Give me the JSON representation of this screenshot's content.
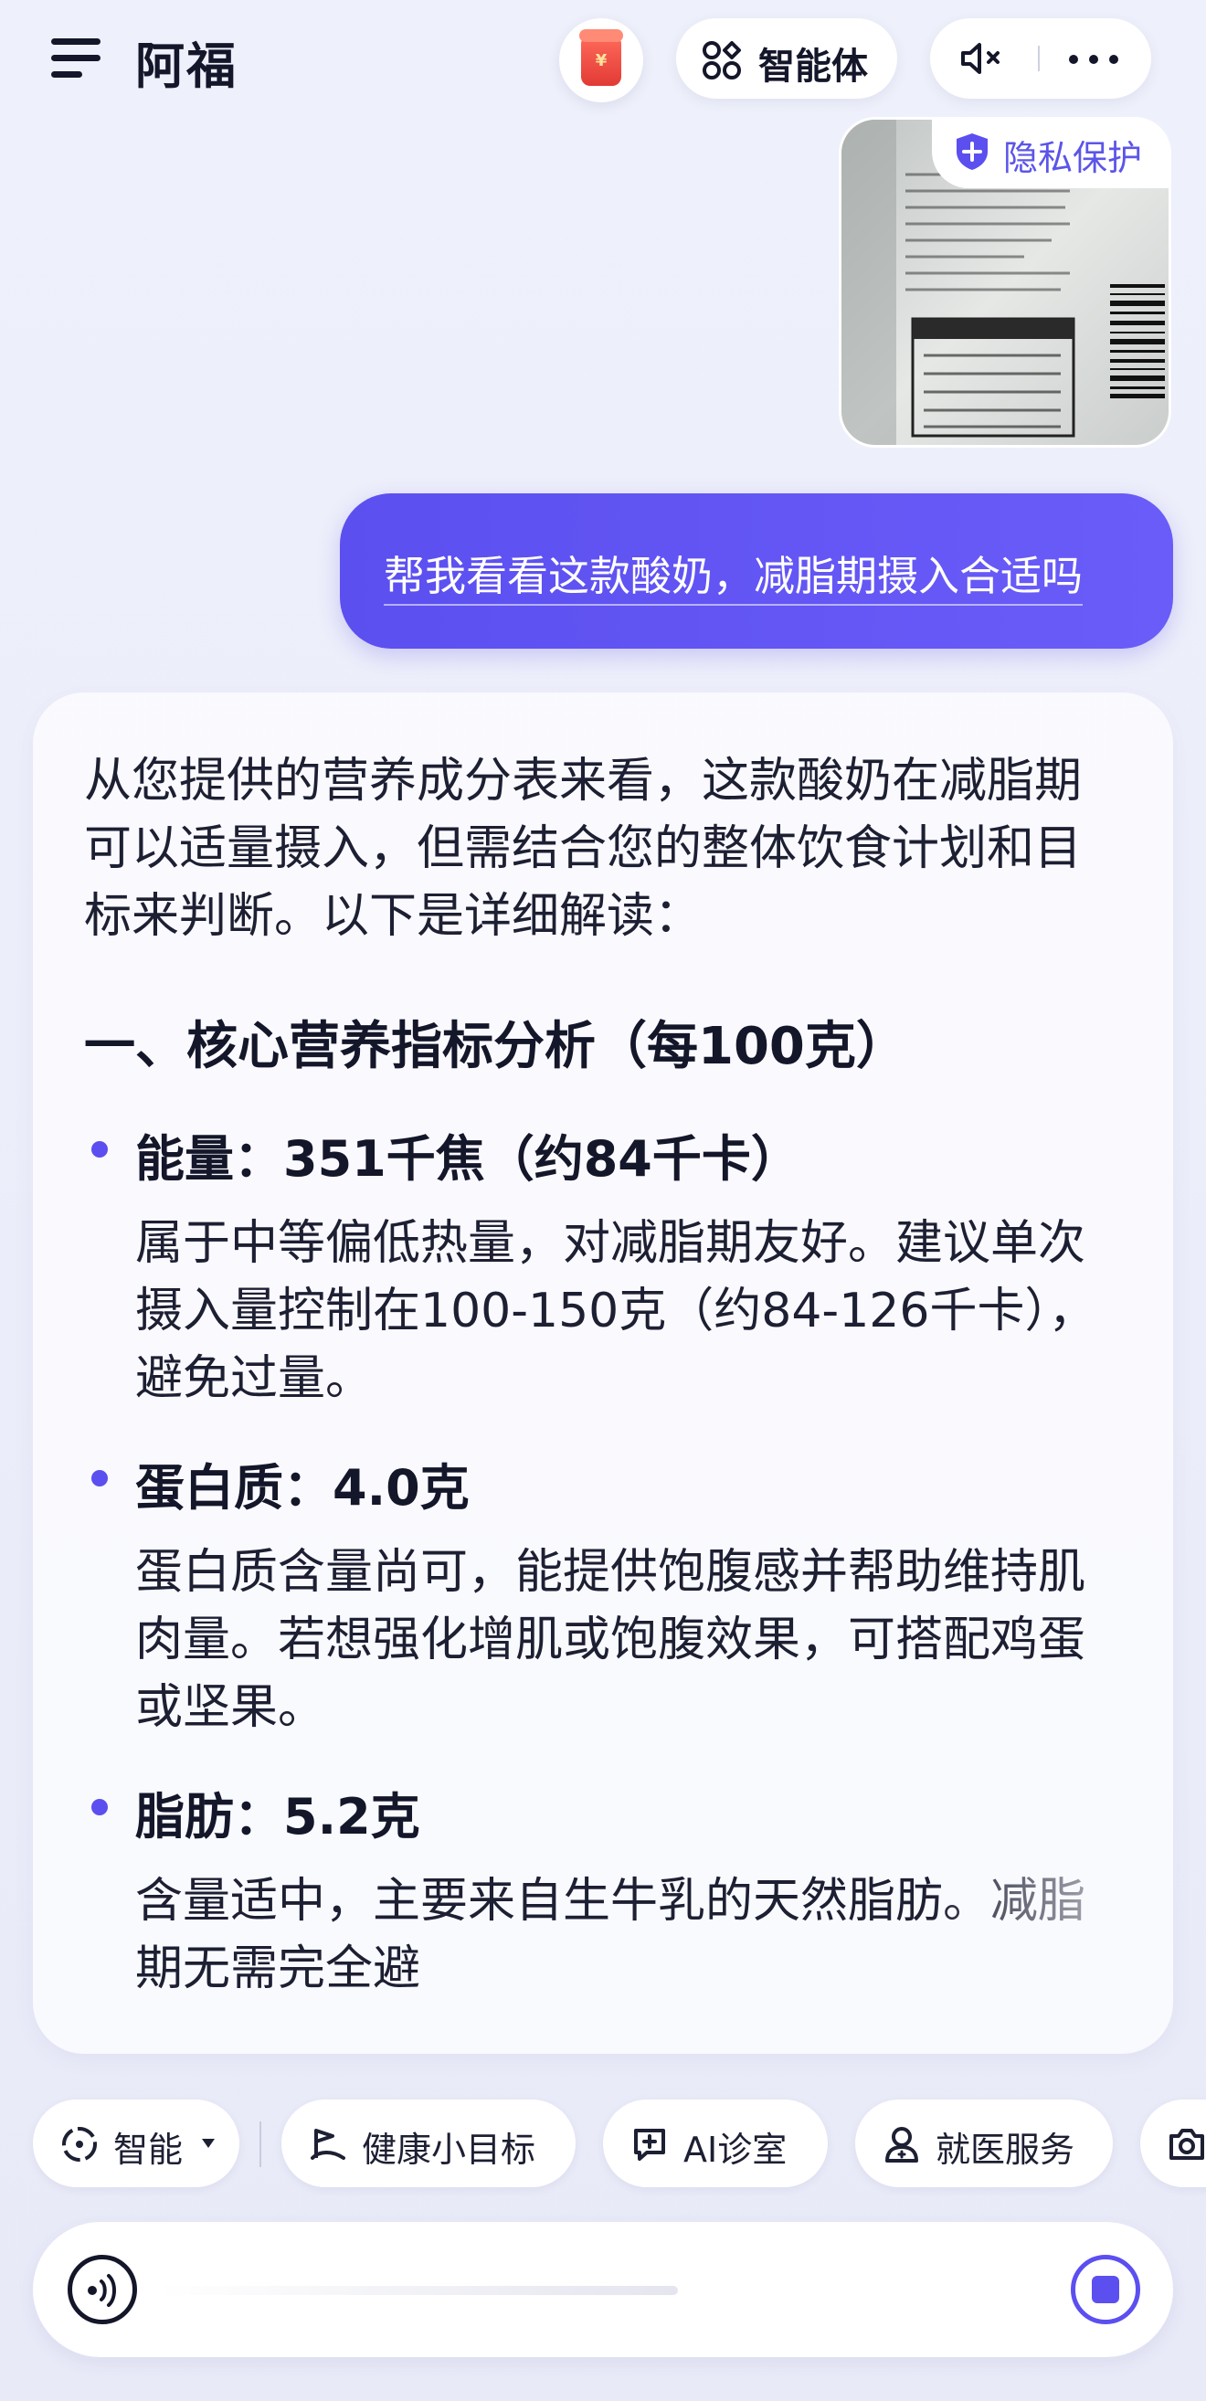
{
  "header": {
    "app_title": "阿福",
    "redpacket_symbol": "¥",
    "agent_label": "智能体"
  },
  "image_message": {
    "privacy_label": "隐私保护"
  },
  "user_message": {
    "text": "帮我看看这款酸奶，减脂期摄入合适吗"
  },
  "answer": {
    "intro": "从您提供的营养成分表来看，这款酸奶在减脂期可以适量摄入，但需结合您的整体饮食计划和目标来判断。以下是详细解读：",
    "section_title": "一、核心营养指标分析（每100克）",
    "items": [
      {
        "title": "能量：351千焦（约84千卡）",
        "body": "属于中等偏低热量，对减脂期友好。建议单次摄入量控制在100-150克（约84-126千卡），避免过量。"
      },
      {
        "title": "蛋白质：4.0克",
        "body": "蛋白质含量尚可，能提供饱腹感并帮助维持肌肉量。若想强化增肌或饱腹效果，可搭配鸡蛋或坚果。"
      },
      {
        "title": "脂肪：5.2克",
        "body": "含量适中，主要来自生牛乳的天然脂肪。减脂期无需完全避"
      }
    ]
  },
  "chips": [
    {
      "label": "智能",
      "icon": "smart-mode-icon"
    },
    {
      "label": "健康小目标",
      "icon": "health-goal-icon"
    },
    {
      "label": "AI诊室",
      "icon": "ai-clinic-icon"
    },
    {
      "label": "就医服务",
      "icon": "medical-service-icon"
    },
    {
      "label": "",
      "icon": "camera-icon"
    }
  ],
  "colors": {
    "accent": "#5b4ff0",
    "text": "#1d1f33"
  }
}
